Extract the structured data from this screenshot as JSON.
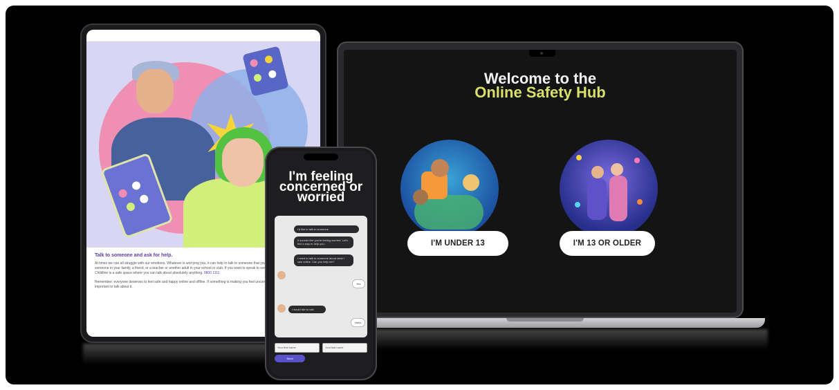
{
  "laptop": {
    "title_line1": "Welcome to the",
    "title_line2": "Online Safety Hub",
    "button_under_13": "I'M UNDER 13",
    "button_13_or_older": "I'M 13 OR OLDER"
  },
  "phone": {
    "heading_line1": "I'm feeling",
    "heading_line2": "concerned or",
    "heading_line3": "worried",
    "chat_messages": [
      "I'd like to talk to someone",
      "It sounds like you're feeling worried. Let's find a way to help you.",
      "I need to talk to someone about what I saw online. Can you help me?",
      "I would like to talk"
    ],
    "user_replies": [
      "Yes",
      "Hello"
    ],
    "inputs": [
      "Your first name",
      "Your last name"
    ],
    "send_label": "Send"
  },
  "tablet": {
    "heading": "Talk to someone and ask for help.",
    "paragraph1": "At times we can all struggle with our emotions. Whatever is worrying you, it can help to talk to someone that you can talk to. Whether it's someone in your family, a friend, or a teacher or another adult in your school or club. If you want to speak to someone you don't know, Childline is a safe space where you can talk about absolutely anything.",
    "paragraph1_link": "0800 1111",
    "paragraph2": "Remember: everyone deserves to feel safe and happy online and offline. If something is making you feel uncomfortable or unsafe, it's important to talk about it."
  },
  "colors": {
    "hub_title_primary": "#f1f1f1",
    "hub_title_accent": "#d8e06a",
    "tablet_heading": "#5b3aa7",
    "phone_send": "#5b52c9"
  }
}
